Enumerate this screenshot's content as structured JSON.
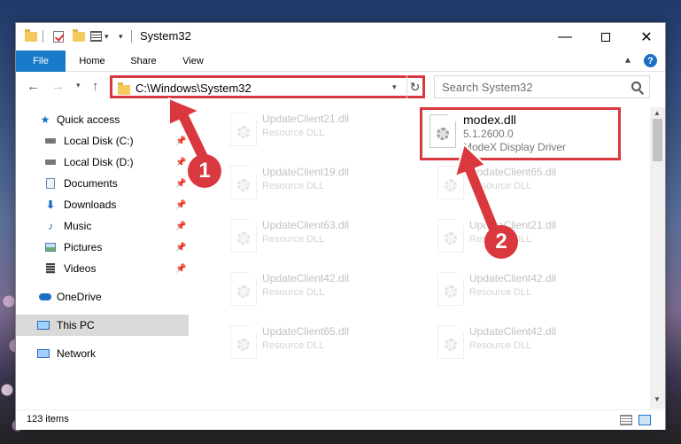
{
  "window": {
    "title": "System32",
    "ribbon_tabs": [
      "File",
      "Home",
      "Share",
      "View"
    ]
  },
  "address_bar": {
    "path": "C:\\Windows\\System32"
  },
  "search": {
    "placeholder": "Search System32"
  },
  "sidebar": {
    "items": [
      {
        "label": "Quick access",
        "icon": "star-icon"
      },
      {
        "label": "Local Disk (C:)",
        "icon": "drive-icon"
      },
      {
        "label": "Local Disk (D:)",
        "icon": "drive-icon"
      },
      {
        "label": "Documents",
        "icon": "documents-icon"
      },
      {
        "label": "Downloads",
        "icon": "download-icon"
      },
      {
        "label": "Music",
        "icon": "music-icon"
      },
      {
        "label": "Pictures",
        "icon": "pictures-icon"
      },
      {
        "label": "Videos",
        "icon": "videos-icon"
      },
      {
        "label": "OneDrive",
        "icon": "cloud-icon"
      },
      {
        "label": "This PC",
        "icon": "computer-icon"
      },
      {
        "label": "Network",
        "icon": "network-icon"
      }
    ]
  },
  "files": {
    "left_column": [
      {
        "name": "UpdateClient21.dll",
        "type": "Resource DLL"
      },
      {
        "name": "UpdateClient19.dll",
        "type": "Resource DLL"
      },
      {
        "name": "UpdateClient63.dll",
        "type": "Resource DLL"
      },
      {
        "name": "UpdateClient42.dll",
        "type": "Resource DLL"
      },
      {
        "name": "UpdateClient65.dll",
        "type": "Resource DLL"
      }
    ],
    "highlighted": {
      "name": "modex.dll",
      "version": "5.1.2600.0",
      "description": "ModeX Display Driver"
    },
    "right_column": [
      {
        "name": "UpdateClient65.dll",
        "type": "Resource DLL"
      },
      {
        "name": "UpdateClient21.dll",
        "type": "Resource DLL"
      },
      {
        "name": "UpdateClient42.dll",
        "type": "Resource DLL"
      },
      {
        "name": "UpdateClient42.dll",
        "type": "Resource DLL"
      }
    ]
  },
  "status": {
    "item_count": "123 items"
  },
  "annotations": {
    "step1": "1",
    "step2": "2"
  },
  "colors": {
    "accent": "#1979ca",
    "highlight": "#d9383f"
  }
}
